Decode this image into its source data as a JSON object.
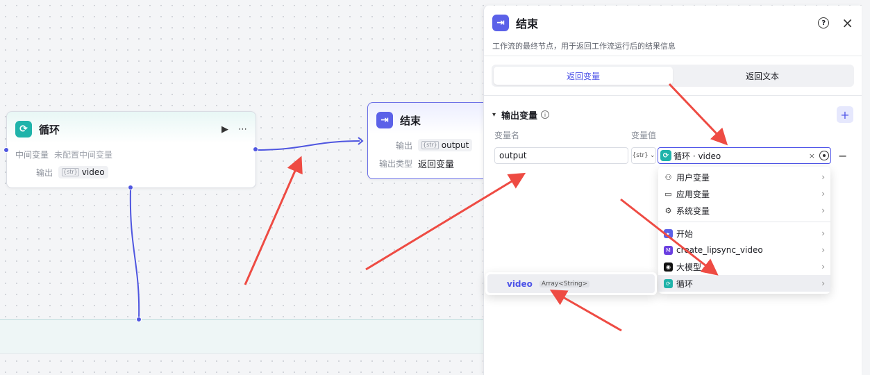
{
  "canvas": {
    "loop_node": {
      "title": "循环",
      "intermediate_label": "中间变量",
      "intermediate_value": "未配置中间变量",
      "output_label": "输出",
      "output_value": "video"
    },
    "end_node": {
      "title": "结束",
      "output_label": "输出",
      "output_value": "output",
      "output_type_label": "输出类型",
      "output_type_value": "返回变量"
    }
  },
  "panel": {
    "title": "结束",
    "description": "工作流的最终节点，用于返回工作流运行后的结果信息",
    "tabs": [
      "返回变量",
      "返回文本"
    ],
    "active_tab": 0,
    "section_title": "输出变量",
    "col_name": "变量名",
    "col_value": "变量值",
    "var_name": "output",
    "var_type_icon": "{str}",
    "var_value": "循环 · video"
  },
  "dropdown": {
    "groups": [
      [
        {
          "label": "用户变量",
          "icon": "user-icon"
        },
        {
          "label": "应用变量",
          "icon": "folder-icon"
        },
        {
          "label": "系统变量",
          "icon": "gear-icon"
        }
      ],
      [
        {
          "label": "开始",
          "icon": "start-node-icon"
        },
        {
          "label": "create_lipsync_video",
          "icon": "plugin-icon"
        },
        {
          "label": "大模型",
          "icon": "llm-icon"
        },
        {
          "label": "循环",
          "icon": "loop-node-icon"
        }
      ]
    ],
    "highlighted": "循环"
  },
  "submenu": {
    "name": "video",
    "type": "Array<String>"
  },
  "colors": {
    "accent": "#4d53e8",
    "loop_teal": "#1fb3aa",
    "annotation_red": "#ee4b43"
  }
}
